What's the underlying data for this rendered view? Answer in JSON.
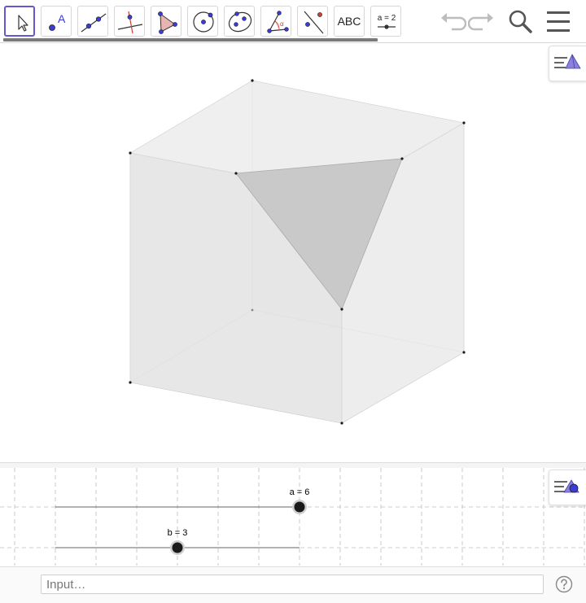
{
  "toolbar": {
    "tools": [
      {
        "name": "move-tool-button",
        "icon": "cursor-arrow-icon",
        "active": true
      },
      {
        "name": "point-tool-button",
        "icon": "point-a-icon",
        "label": "A"
      },
      {
        "name": "line-tool-button",
        "icon": "line-through-points-icon"
      },
      {
        "name": "perpendicular-line-tool-button",
        "icon": "perpendicular-line-icon"
      },
      {
        "name": "polygon-tool-button",
        "icon": "polygon-icon"
      },
      {
        "name": "circle-tool-button",
        "icon": "circle-center-point-icon"
      },
      {
        "name": "ellipse-tool-button",
        "icon": "ellipse-icon"
      },
      {
        "name": "angle-tool-button",
        "icon": "angle-icon",
        "label": "α"
      },
      {
        "name": "reflect-tool-button",
        "icon": "reflect-line-icon"
      },
      {
        "name": "text-tool-button",
        "icon": "text-icon",
        "label": "ABC"
      },
      {
        "name": "slider-tool-button",
        "icon": "slider-icon",
        "label": "a = 2"
      }
    ],
    "undo_icon": "undo-icon",
    "redo_icon": "redo-icon",
    "search_icon": "search-icon",
    "menu_icon": "hamburger-menu-icon"
  },
  "graphics3d": {
    "style_bar_icon": "style-bar-3d-icon",
    "face_color": "#e6e6e6",
    "triangle_color": "#c4c4c4"
  },
  "graphics2d": {
    "style_bar_icon": "style-bar-2d-icon",
    "sliders": [
      {
        "name": "a",
        "label": "a = 6",
        "value": 6,
        "min": 0,
        "max": 6
      },
      {
        "name": "b",
        "label": "b = 3",
        "value": 3,
        "min": 0,
        "max": 6
      }
    ]
  },
  "input_bar": {
    "placeholder": "Input…",
    "help_icon": "help-icon"
  },
  "colors": {
    "accent": "#6557d2",
    "point": "#1a1a1a"
  }
}
